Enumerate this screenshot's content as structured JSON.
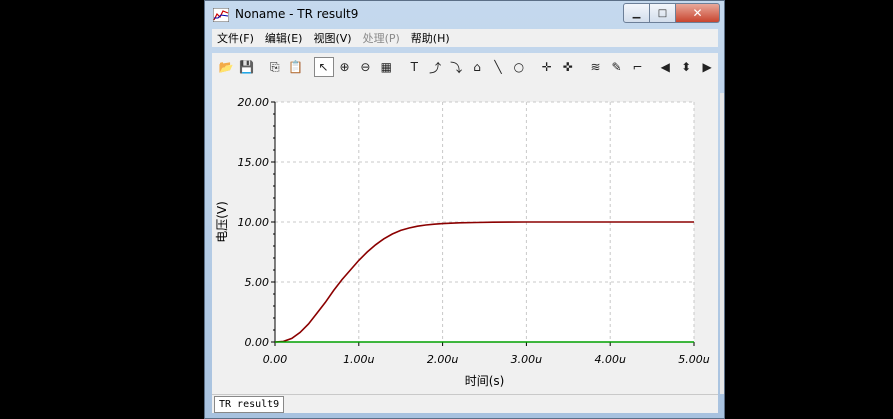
{
  "window": {
    "title": "Noname - TR result9"
  },
  "menu": [
    {
      "label": "文件(F)",
      "enabled": true
    },
    {
      "label": "编辑(E)",
      "enabled": true
    },
    {
      "label": "视图(V)",
      "enabled": true
    },
    {
      "label": "处理(P)",
      "enabled": false
    },
    {
      "label": "帮助(H)",
      "enabled": true
    }
  ],
  "toolbar": {
    "buttons": [
      "open-icon",
      "save-icon",
      "sep",
      "copy-icon",
      "paste-icon",
      "sep",
      "pointer-icon",
      "zoom-in-icon",
      "zoom-out-100-icon",
      "grid-icon",
      "sep",
      "text-tool-icon",
      "curve-label-icon",
      "curve-label-z-icon",
      "curve-label-value-icon",
      "line-tool-icon",
      "circle-tool-icon",
      "sep",
      "cursor-a-icon",
      "cursor-b-icon",
      "sep",
      "add-curve-icon",
      "pen-icon",
      "marker-icon",
      "sep",
      "scroll-left-icon",
      "scroll-up-down-icon",
      "scroll-right-icon"
    ]
  },
  "status": {
    "tab_label": "TR result9"
  },
  "chart_data": {
    "type": "line",
    "xlabel": "时间(s)",
    "ylabel": "电压(V)",
    "xlim": [
      0,
      5
    ],
    "ylim": [
      0,
      20
    ],
    "x_ticks": [
      "0.00",
      "1.00u",
      "2.00u",
      "3.00u",
      "4.00u",
      "5.00u"
    ],
    "y_ticks": [
      "0.00",
      "5.00",
      "10.00",
      "15.00",
      "20.00"
    ],
    "grid": true,
    "series": [
      {
        "color": "#8b0000",
        "x": [
          0,
          0.1,
          0.2,
          0.3,
          0.4,
          0.5,
          0.6,
          0.7,
          0.8,
          0.9,
          1.0,
          1.1,
          1.2,
          1.3,
          1.4,
          1.5,
          1.6,
          1.7,
          1.8,
          1.9,
          2.0,
          2.2,
          2.4,
          2.6,
          2.8,
          3.0,
          3.5,
          4.0,
          4.5,
          5.0
        ],
        "y": [
          0,
          0.05,
          0.3,
          0.8,
          1.5,
          2.4,
          3.3,
          4.3,
          5.2,
          6.0,
          6.8,
          7.5,
          8.1,
          8.6,
          9.0,
          9.3,
          9.5,
          9.65,
          9.75,
          9.82,
          9.87,
          9.93,
          9.96,
          9.98,
          9.99,
          10.0,
          10.0,
          10.0,
          10.0,
          10.0
        ]
      },
      {
        "color": "#00a000",
        "x": [
          0,
          5
        ],
        "y": [
          0,
          0
        ]
      }
    ]
  }
}
